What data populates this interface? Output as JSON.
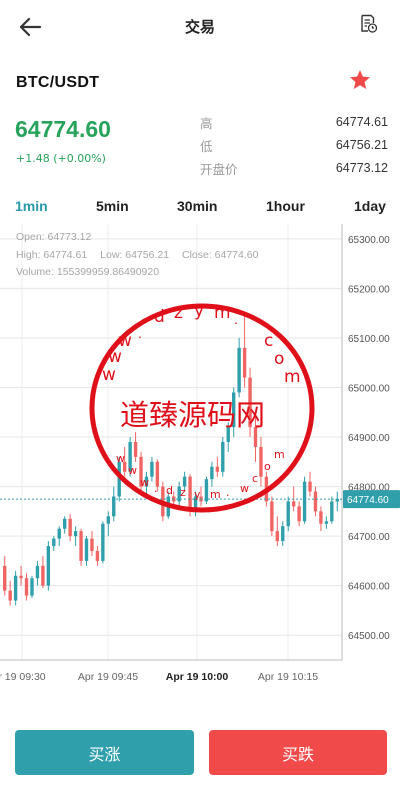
{
  "header": {
    "title": "交易",
    "back_icon": "arrow-left-icon",
    "record_icon": "order-record-icon"
  },
  "market": {
    "pair": "BTC/USDT",
    "favorite_icon": "star-icon",
    "favorite_color": "#f04a4a",
    "price": "64774.60",
    "change": "+1.48 (+0.00%)",
    "up_color": "#27a35c",
    "stats": [
      {
        "label": "高",
        "value": "64774.61"
      },
      {
        "label": "低",
        "value": "64756.21"
      },
      {
        "label": "开盘价",
        "value": "64773.12"
      }
    ]
  },
  "tabs": [
    {
      "label": "1min",
      "active": true
    },
    {
      "label": "5min",
      "active": false
    },
    {
      "label": "30min",
      "active": false
    },
    {
      "label": "1hour",
      "active": false
    },
    {
      "label": "1day",
      "active": false
    }
  ],
  "ohlc": {
    "open": "Open:  64773.12",
    "high": "High:  64774.61",
    "low": "Low:  64756.21",
    "close": "Close:  64774.60",
    "volume": "Volume:  155399959.86490920"
  },
  "watermark": {
    "site_text": "www.dzym.com",
    "cn_text": "道臻源码网",
    "bottom_text": "www.dzym.com",
    "color": "#e0101a"
  },
  "chart_data": {
    "type": "candlestick",
    "y_ticks": [
      "65300.00",
      "65200.00",
      "65100.00",
      "65000.00",
      "64900.00",
      "64800.00",
      "64700.00",
      "64600.00",
      "64500.00"
    ],
    "x_ticks": [
      "r 19 09:30",
      "Apr 19 09:45",
      "Apr 19 10:00",
      "Apr 19 10:15"
    ],
    "x_tick_bold": [
      false,
      false,
      true,
      false
    ],
    "ylim": [
      64450,
      65330
    ],
    "last_price": "64774.60",
    "up_color": "#2e9fab",
    "down_color": "#f06464",
    "candles": [
      [
        64640,
        64660,
        64580,
        64590
      ],
      [
        64590,
        64610,
        64560,
        64570
      ],
      [
        64570,
        64630,
        64560,
        64620
      ],
      [
        64620,
        64640,
        64600,
        64615
      ],
      [
        64615,
        64625,
        64570,
        64580
      ],
      [
        64580,
        64620,
        64575,
        64615
      ],
      [
        64615,
        64650,
        64600,
        64640
      ],
      [
        64640,
        64660,
        64595,
        64600
      ],
      [
        64600,
        64690,
        64590,
        64680
      ],
      [
        64680,
        64700,
        64670,
        64695
      ],
      [
        64695,
        64720,
        64680,
        64715
      ],
      [
        64715,
        64740,
        64705,
        64735
      ],
      [
        64735,
        64745,
        64690,
        64700
      ],
      [
        64700,
        64720,
        64680,
        64710
      ],
      [
        64710,
        64715,
        64640,
        64650
      ],
      [
        64650,
        64700,
        64640,
        64695
      ],
      [
        64695,
        64710,
        64660,
        64670
      ],
      [
        64670,
        64680,
        64640,
        64650
      ],
      [
        64650,
        64730,
        64645,
        64725
      ],
      [
        64725,
        64750,
        64700,
        64740
      ],
      [
        64740,
        64800,
        64730,
        64780
      ],
      [
        64780,
        64860,
        64770,
        64850
      ],
      [
        64850,
        64880,
        64820,
        64830
      ],
      [
        64830,
        64900,
        64820,
        64890
      ],
      [
        64890,
        64910,
        64850,
        64860
      ],
      [
        64860,
        64870,
        64790,
        64800
      ],
      [
        64800,
        64830,
        64780,
        64820
      ],
      [
        64820,
        64860,
        64810,
        64850
      ],
      [
        64850,
        64855,
        64790,
        64800
      ],
      [
        64800,
        64810,
        64730,
        64740
      ],
      [
        64740,
        64790,
        64735,
        64780
      ],
      [
        64780,
        64790,
        64760,
        64770
      ],
      [
        64770,
        64810,
        64760,
        64800
      ],
      [
        64800,
        64830,
        64790,
        64820
      ],
      [
        64820,
        64825,
        64740,
        64750
      ],
      [
        64750,
        64790,
        64740,
        64780
      ],
      [
        64780,
        64800,
        64760,
        64770
      ],
      [
        64770,
        64820,
        64765,
        64815
      ],
      [
        64815,
        64850,
        64800,
        64840
      ],
      [
        64840,
        64860,
        64820,
        64830
      ],
      [
        64830,
        64900,
        64820,
        64890
      ],
      [
        64890,
        64930,
        64870,
        64920
      ],
      [
        64920,
        65000,
        64900,
        64990
      ],
      [
        64990,
        65100,
        64980,
        65080
      ],
      [
        65080,
        65150,
        65000,
        65020
      ],
      [
        65020,
        65040,
        64900,
        64920
      ],
      [
        64920,
        64950,
        64850,
        64880
      ],
      [
        64880,
        64900,
        64800,
        64820
      ],
      [
        64820,
        64830,
        64760,
        64770
      ],
      [
        64770,
        64780,
        64700,
        64710
      ],
      [
        64710,
        64740,
        64680,
        64690
      ],
      [
        64690,
        64730,
        64680,
        64720
      ],
      [
        64720,
        64780,
        64710,
        64770
      ],
      [
        64770,
        64800,
        64750,
        64760
      ],
      [
        64760,
        64770,
        64720,
        64730
      ],
      [
        64730,
        64820,
        64725,
        64810
      ],
      [
        64810,
        64830,
        64780,
        64790
      ],
      [
        64790,
        64800,
        64740,
        64750
      ],
      [
        64750,
        64760,
        64710,
        64725
      ],
      [
        64725,
        64740,
        64715,
        64730
      ],
      [
        64730,
        64780,
        64725,
        64770
      ],
      [
        64770,
        64790,
        64750,
        64775
      ]
    ]
  },
  "actions": {
    "buy_label": "买涨",
    "sell_label": "买跌"
  }
}
